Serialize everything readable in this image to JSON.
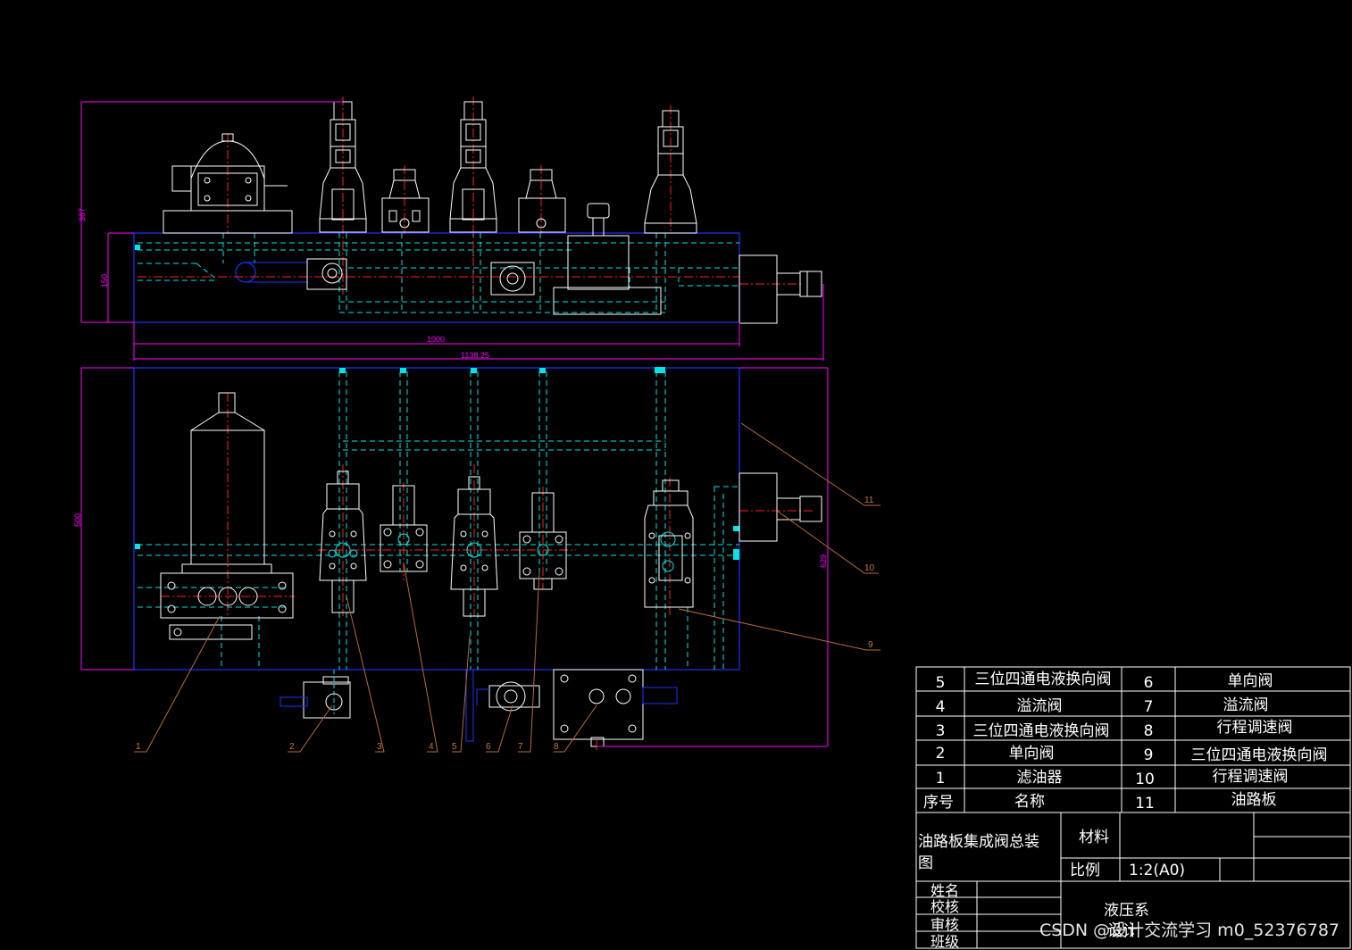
{
  "dimensions": {
    "height_top": "367",
    "plate_height": "150",
    "plate_length": "1000",
    "overall_length": "1138.25",
    "width_bottom": "500",
    "overall_depth": "629"
  },
  "callouts": [
    "1",
    "2",
    "3",
    "4",
    "5",
    "6",
    "7",
    "8",
    "9",
    "10",
    "11"
  ],
  "bom": {
    "rows": [
      {
        "no_left": "5",
        "name_left": "三位四通电液换向阀",
        "no_right": "6",
        "name_right": "单向阀"
      },
      {
        "no_left": "4",
        "name_left": "溢流阀",
        "no_right": "7",
        "name_right": "溢流阀"
      },
      {
        "no_left": "3",
        "name_left": "三位四通电液换向阀",
        "no_right": "8",
        "name_right": "行程调速阀"
      },
      {
        "no_left": "2",
        "name_left": "单向阀",
        "no_right": "9",
        "name_right": "三位四通电液换向阀"
      },
      {
        "no_left": "1",
        "name_left": "滤油器",
        "no_right": "10",
        "name_right": "行程调速阀"
      },
      {
        "no_left": "序号",
        "name_left": "名称",
        "no_right": "11",
        "name_right": "油路板"
      }
    ]
  },
  "title_block": {
    "drawing_title_line1": "油路板集成阀总装",
    "drawing_title_line2": "图",
    "material_label": "材料",
    "scale_label": "比例",
    "scale_value": "1:2(A0)",
    "sign_labels": [
      "姓名",
      "校核",
      "审核",
      "班级"
    ],
    "department": "液压系",
    "department_overlap": "设计"
  },
  "watermark": "CSDN @设计交流学习 m0_52376787",
  "colors": {
    "background": "#000000",
    "plate": "#1a33ff",
    "hidden_lines": "#00e5e5",
    "centerline": "#ff2020",
    "dimension": "#ff00ff",
    "leader": "#b86a34",
    "outline": "#ffffff"
  }
}
